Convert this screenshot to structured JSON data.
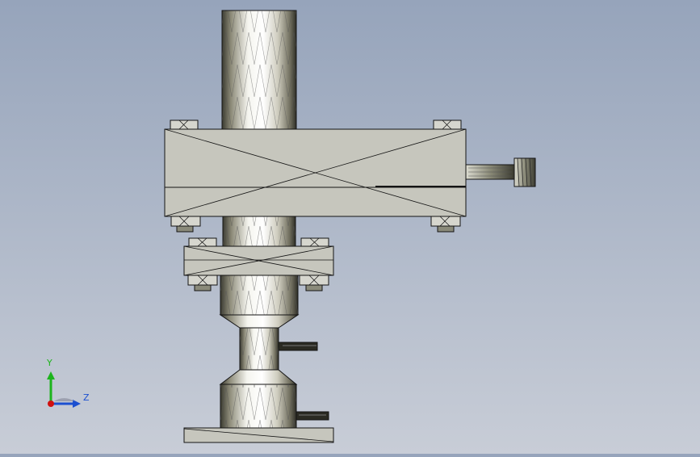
{
  "viewport": {
    "background_top": "#96a4bb",
    "background_bottom": "#c8cdd7",
    "model_fill": "#c6c6bd",
    "model_edge": "#141414",
    "shaft_light": "#f5f5ef",
    "shaft_dark": "#3a3a30"
  },
  "triad": {
    "y_label": "Y",
    "z_label": "Z",
    "y_color": "#1db41d",
    "z_color": "#1b4fd0",
    "origin_color": "#d01010",
    "icon": "coordinate-triad-icon"
  }
}
